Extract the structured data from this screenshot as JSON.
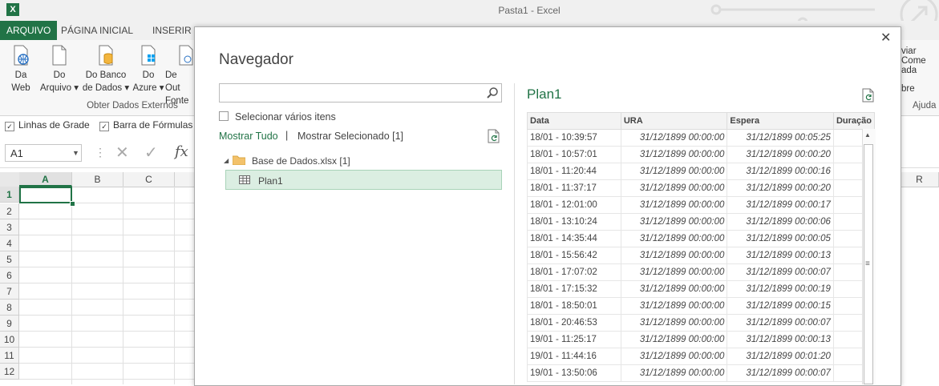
{
  "window": {
    "title": "Pasta1 - Excel",
    "app_icon": "X"
  },
  "tabs": [
    "ARQUIVO",
    "PÁGINA INICIAL",
    "INSERIR"
  ],
  "ribbon": {
    "buttons": [
      {
        "line1": "Da",
        "line2": "Web",
        "icon": "web-icon"
      },
      {
        "line1": "Do",
        "line2": "Arquivo ▾",
        "icon": "file-icon"
      },
      {
        "line1": "Do Banco",
        "line2": "de Dados ▾",
        "icon": "database-icon"
      },
      {
        "line1": "Do",
        "line2": "Azure ▾",
        "icon": "azure-icon"
      },
      {
        "line1": "De Out",
        "line2": "Fonte",
        "icon": "other-sources-icon"
      }
    ],
    "group_label": "Obter Dados Externos",
    "right_texts": [
      "viar Come",
      "ada",
      "bre"
    ],
    "help_group": "Ajuda"
  },
  "view_options": {
    "gridlines": {
      "label": "Linhas de Grade",
      "checked": true
    },
    "formula_bar": {
      "label": "Barra de Fórmulas",
      "checked": true
    }
  },
  "formula_bar": {
    "name_box": "A1",
    "fx": "fx"
  },
  "sheet": {
    "columns": [
      "A",
      "B",
      "C"
    ],
    "far_column": "R",
    "rows": [
      "1",
      "2",
      "3",
      "4",
      "5",
      "6",
      "7",
      "8",
      "9",
      "10",
      "11",
      "12"
    ]
  },
  "navigator": {
    "title": "Navegador",
    "search_placeholder": "",
    "select_multiple": "Selecionar vários itens",
    "show_all": "Mostrar Tudo",
    "separator": "|",
    "show_selected": "Mostrar Selecionado [1]",
    "tree": {
      "folder": "Base de Dados.xlsx [1]",
      "item": "Plan1"
    },
    "preview": {
      "title": "Plan1",
      "columns": [
        "Data",
        "URA",
        "Espera",
        "Duração"
      ],
      "rows": [
        [
          "18/01 - 10:39:57",
          "31/12/1899 00:00:00",
          "31/12/1899 00:05:25",
          ""
        ],
        [
          "18/01 - 10:57:01",
          "31/12/1899 00:00:00",
          "31/12/1899 00:00:20",
          ""
        ],
        [
          "18/01 - 11:20:44",
          "31/12/1899 00:00:00",
          "31/12/1899 00:00:16",
          ""
        ],
        [
          "18/01 - 11:37:17",
          "31/12/1899 00:00:00",
          "31/12/1899 00:00:20",
          ""
        ],
        [
          "18/01 - 12:01:00",
          "31/12/1899 00:00:00",
          "31/12/1899 00:00:17",
          ""
        ],
        [
          "18/01 - 13:10:24",
          "31/12/1899 00:00:00",
          "31/12/1899 00:00:06",
          ""
        ],
        [
          "18/01 - 14:35:44",
          "31/12/1899 00:00:00",
          "31/12/1899 00:00:05",
          ""
        ],
        [
          "18/01 - 15:56:42",
          "31/12/1899 00:00:00",
          "31/12/1899 00:00:13",
          ""
        ],
        [
          "18/01 - 17:07:02",
          "31/12/1899 00:00:00",
          "31/12/1899 00:00:07",
          ""
        ],
        [
          "18/01 - 17:15:32",
          "31/12/1899 00:00:00",
          "31/12/1899 00:00:19",
          ""
        ],
        [
          "18/01 - 18:50:01",
          "31/12/1899 00:00:00",
          "31/12/1899 00:00:15",
          ""
        ],
        [
          "18/01 - 20:46:53",
          "31/12/1899 00:00:00",
          "31/12/1899 00:00:07",
          ""
        ],
        [
          "19/01 - 11:25:17",
          "31/12/1899 00:00:00",
          "31/12/1899 00:00:13",
          ""
        ],
        [
          "19/01 - 11:44:16",
          "31/12/1899 00:00:00",
          "31/12/1899 00:01:20",
          ""
        ],
        [
          "19/01 - 13:50:06",
          "31/12/1899 00:00:00",
          "31/12/1899 00:00:07",
          ""
        ]
      ]
    }
  },
  "colors": {
    "accent": "#217346",
    "selection_bg": "#dbeee2"
  }
}
